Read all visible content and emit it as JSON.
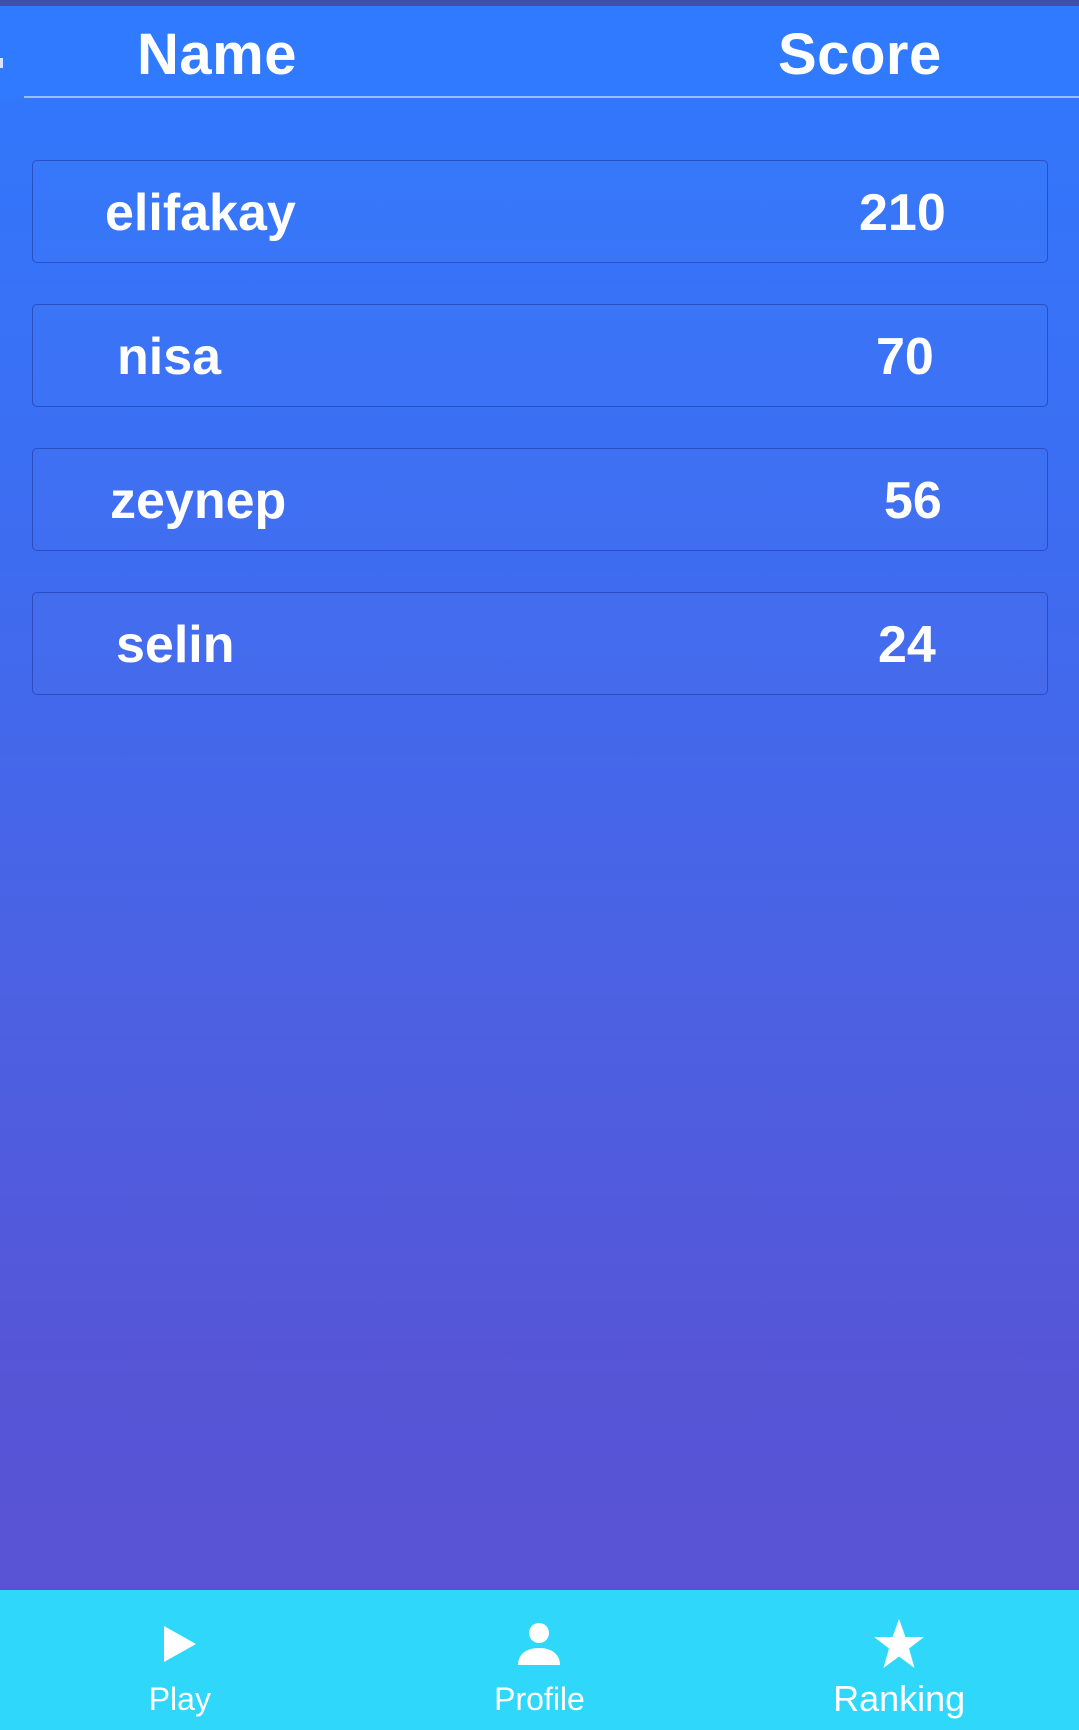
{
  "header": {
    "name_label": "Name",
    "score_label": "Score"
  },
  "rankings": [
    {
      "name": "elifakay",
      "score": "210"
    },
    {
      "name": "nisa",
      "score": "70"
    },
    {
      "name": "zeynep",
      "score": "56"
    },
    {
      "name": "selin",
      "score": "24"
    }
  ],
  "bottom_nav": {
    "items": [
      {
        "label": "Play",
        "icon": "play-icon"
      },
      {
        "label": "Profile",
        "icon": "person-icon"
      },
      {
        "label": "Ranking",
        "icon": "star-icon",
        "active": true
      }
    ]
  },
  "colors": {
    "header_bg": "#2f7afe",
    "gradient_top": "#3079fe",
    "gradient_bottom": "#5a52d4",
    "nav_bg": "#2fd8fb",
    "text": "#ffffff"
  }
}
